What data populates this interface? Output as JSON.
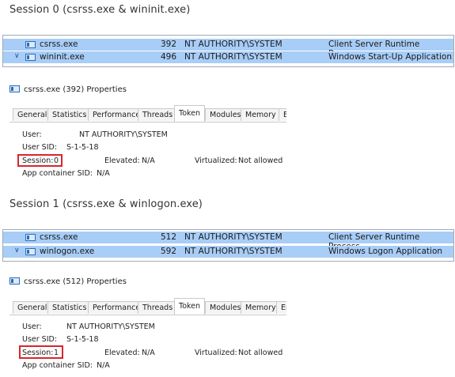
{
  "sections": [
    {
      "heading": "Session 0 (csrss.exe & wininit.exe)",
      "rows": [
        {
          "chevron": "",
          "name": "csrss.exe",
          "pid": "392",
          "user": "NT AUTHORITY\\SYSTEM",
          "description": "Client Server Runtime Process"
        },
        {
          "chevron": "∨",
          "name": "wininit.exe",
          "pid": "496",
          "user": "NT AUTHORITY\\SYSTEM",
          "description": "Windows Start-Up Application"
        }
      ],
      "props_title": "csrss.exe (392) Properties",
      "tabs": [
        "General",
        "Statistics",
        "Performance",
        "Threads",
        "Token",
        "Modules",
        "Memory",
        "E"
      ],
      "active_tab": "Token",
      "token": {
        "user_label": "User:",
        "user_value": "NT AUTHORITY\\SYSTEM",
        "sid_label": "User SID:",
        "sid_value": "S-1-5-18",
        "session_label": "Session:",
        "session_value": "0",
        "elevated_label": "Elevated:",
        "elevated_value": "N/A",
        "virtualized_label": "Virtualized:",
        "virtualized_value": "Not allowed",
        "appcontainer_label": "App container SID:",
        "appcontainer_value": "N/A"
      }
    },
    {
      "heading": "Session 1 (csrss.exe & winlogon.exe)",
      "rows": [
        {
          "chevron": "",
          "name": "csrss.exe",
          "pid": "512",
          "user": "NT AUTHORITY\\SYSTEM",
          "description": "Client Server Runtime Process"
        },
        {
          "chevron": "∨",
          "name": "winlogon.exe",
          "pid": "592",
          "user": "NT AUTHORITY\\SYSTEM",
          "description": "Windows Logon Application"
        }
      ],
      "props_title": "csrss.exe (512) Properties",
      "tabs": [
        "General",
        "Statistics",
        "Performance",
        "Threads",
        "Token",
        "Modules",
        "Memory",
        "En"
      ],
      "active_tab": "Token",
      "token": {
        "user_label": "User:",
        "user_value": "NT AUTHORITY\\SYSTEM",
        "sid_label": "User SID:",
        "sid_value": "S-1-5-18",
        "session_label": "Session:",
        "session_value": "1",
        "elevated_label": "Elevated:",
        "elevated_value": "N/A",
        "virtualized_label": "Virtualized:",
        "virtualized_value": "Not allowed",
        "appcontainer_label": "App container SID:",
        "appcontainer_value": "N/A"
      }
    }
  ],
  "colors": {
    "row_highlight": "#a8cdf7",
    "session_outline": "#d9252a"
  },
  "icons": {
    "process": "window-icon",
    "expand": "chevron-down-icon"
  }
}
